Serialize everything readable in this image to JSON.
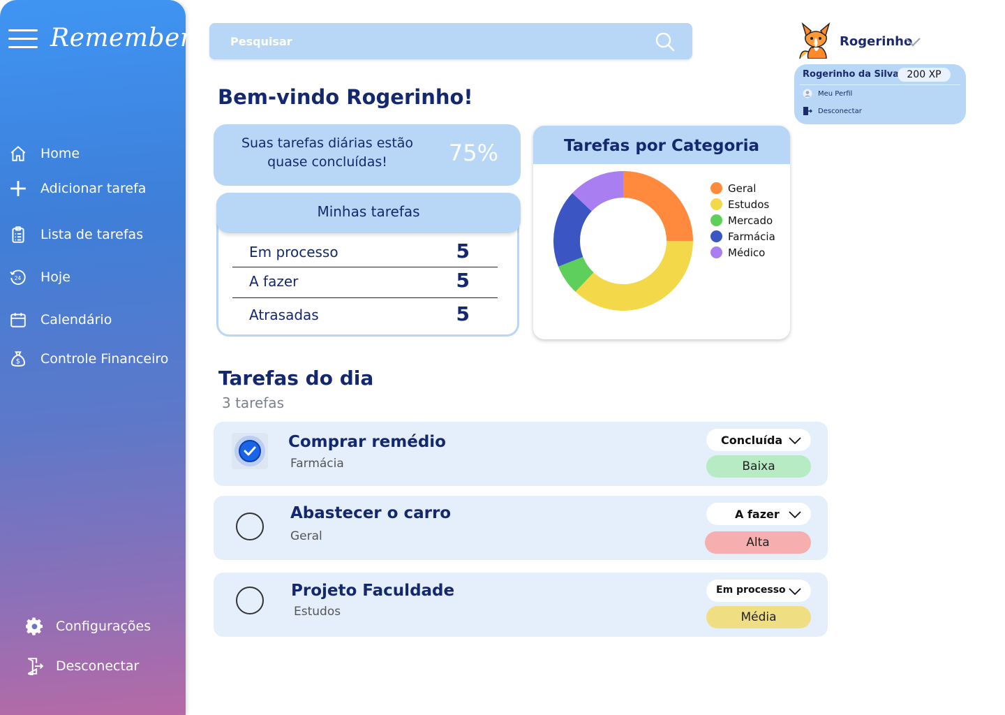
{
  "app": {
    "logo": "Remember"
  },
  "sidebar": {
    "items": [
      {
        "label": "Home",
        "icon": "home-icon"
      },
      {
        "label": "Adicionar tarefa",
        "icon": "plus-icon"
      },
      {
        "label": "Lista de tarefas",
        "icon": "clipboard-icon"
      },
      {
        "label": "Hoje",
        "icon": "24h-icon"
      },
      {
        "label": "Calendário",
        "icon": "calendar-icon"
      },
      {
        "label": "Controle Financeiro",
        "icon": "money-bag-icon"
      }
    ],
    "bottom": [
      {
        "label": "Configurações",
        "icon": "gear-icon"
      },
      {
        "label": "Desconectar",
        "icon": "logout-icon"
      }
    ]
  },
  "search": {
    "placeholder": "Pesquisar"
  },
  "profile": {
    "name": "Rogerinho",
    "full_name": "Rogerinho da Silva",
    "xp": "200  XP",
    "links": [
      "Meu Perfil",
      "Desconectar"
    ]
  },
  "welcome": "Bem-vindo Rogerinho!",
  "progress": {
    "text": "Suas tarefas diárias estão quase concluídas!",
    "value": "75%"
  },
  "my_tasks": {
    "title": "Minhas tarefas",
    "rows": [
      {
        "label": "Em processo",
        "count": "5"
      },
      {
        "label": "A fazer",
        "count": "5"
      },
      {
        "label": "Atrasadas",
        "count": "5"
      }
    ]
  },
  "chart_data": {
    "type": "pie",
    "title": "Tarefas por Categoria",
    "categories": [
      "Geral",
      "Estudos",
      "Mercado",
      "Farmácia",
      "Médico"
    ],
    "values": [
      25,
      37,
      7,
      18,
      13
    ],
    "colors": [
      "#ff8a3d",
      "#f3d94a",
      "#5dcf5a",
      "#3b56c2",
      "#a97ef0"
    ]
  },
  "day": {
    "title": "Tarefas do dia",
    "count": "3 tarefas",
    "tasks": [
      {
        "title": "Comprar remédio",
        "category": "Farmácia",
        "status": "Concluída",
        "priority": "Baixa",
        "priority_color": "#b6ebc4",
        "done": true
      },
      {
        "title": "Abastecer o carro",
        "category": "Geral",
        "status": "A fazer",
        "priority": "Alta",
        "priority_color": "#f6aeae",
        "done": false
      },
      {
        "title": "Projeto Faculdade",
        "category": "Estudos",
        "status": "Em processo",
        "priority": "Média",
        "priority_color": "#f0de82",
        "done": false
      }
    ]
  }
}
